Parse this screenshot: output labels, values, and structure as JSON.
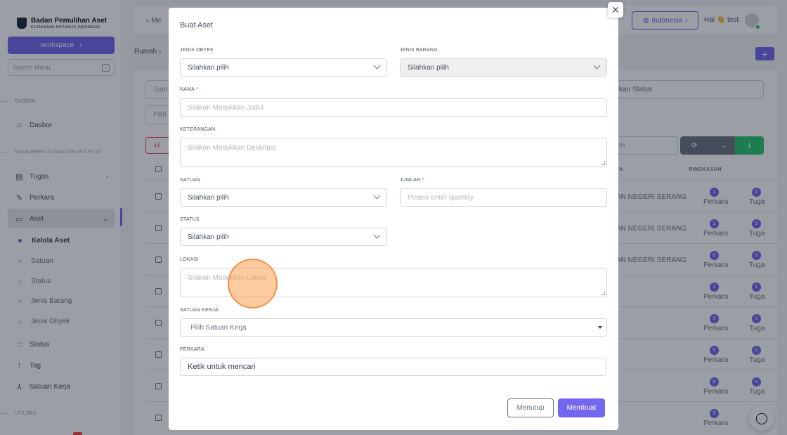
{
  "brand": {
    "title": "Badan Pemulihan Aset",
    "subtitle": "KEJAKSAAN REPUBLIK INDONESIA"
  },
  "sidebar": {
    "workspace_label": "workspace",
    "search_placeholder": "Search Menu...",
    "search_shortcut": "/",
    "sections": [
      "DASBOR",
      "MANAJEMEN TUGAS DAN AKTIFITAS",
      "UTILITAS"
    ],
    "items": {
      "dasbor": "Dasbor",
      "tugas": "Tugas",
      "perkara": "Perkara",
      "aset": "Aset",
      "kelola_aset": "Kelola Aset",
      "satuan": "Satuan",
      "status_sub": "Status",
      "jenis_barang": "Jenis Barang",
      "jenis_obyek": "Jenis Obyek",
      "status": "Status",
      "tag": "Tag",
      "satuan_kerja": "Satuan Kerja"
    }
  },
  "topbar": {
    "search_text": "Me",
    "language": "Indonesia",
    "greeting": "Hai 👋 test"
  },
  "page": {
    "breadcrumb": "Rumah",
    "filter_left": "Sarin",
    "filter_right": "kan Status",
    "pick_placeholder": "Pilih",
    "delete_label": "H",
    "search_partial": "th",
    "col_unit": "JA",
    "col_summary": "RINGKASAN",
    "rows": [
      {
        "unit": "AN NEGERI SERANG",
        "perkara": "1",
        "tugas": "0"
      },
      {
        "unit": "AN NEGERI SERANG",
        "perkara": "1",
        "tugas": "0"
      },
      {
        "unit": "AN NEGERI SERANG",
        "perkara": "0",
        "tugas": "0"
      },
      {
        "unit": "",
        "perkara": "1",
        "tugas": "1"
      },
      {
        "unit": "",
        "perkara": "0",
        "tugas": "0"
      },
      {
        "unit": "",
        "perkara": "0",
        "tugas": "0"
      },
      {
        "unit": "",
        "perkara": "0",
        "tugas": "0"
      },
      {
        "unit": "",
        "perkara": "0",
        "tugas": ""
      }
    ],
    "badge_perkara": "Perkara",
    "badge_tugas": "Tuga"
  },
  "modal": {
    "title": "Buat Aset",
    "jenis_obyek": {
      "label": "JENIS OBYEK",
      "value": "Silahkan pilih"
    },
    "jenis_barang": {
      "label": "JENIS BARANG",
      "value": "Silahkan pilih"
    },
    "nama": {
      "label": "NAMA",
      "placeholder": "Silakan Masukkan Judul"
    },
    "keterangan": {
      "label": "KETERANGAN",
      "placeholder": "Silakan Masukkan Deskripsi"
    },
    "satuan": {
      "label": "SATUAN",
      "value": "Silahkan pilih"
    },
    "jumlah": {
      "label": "JUMLAH",
      "placeholder": "Please enter quantity"
    },
    "status": {
      "label": "STATUS",
      "value": "Silahkan pilih"
    },
    "lokasi": {
      "label": "LOKASI",
      "placeholder": "Silakan Masukkan Lokasi"
    },
    "satuan_kerja": {
      "label": "SATUAN KERJA",
      "value": "Pilih Satuan Kerja"
    },
    "perkara": {
      "label": "PERKARA",
      "value": "Ketik untuk mencari"
    },
    "close_label": "Menutup",
    "create_label": "Membuat",
    "required_mark": "*"
  },
  "colors": {
    "accent": "#7367f0",
    "success": "#28c76f",
    "danger": "#ef4444"
  }
}
